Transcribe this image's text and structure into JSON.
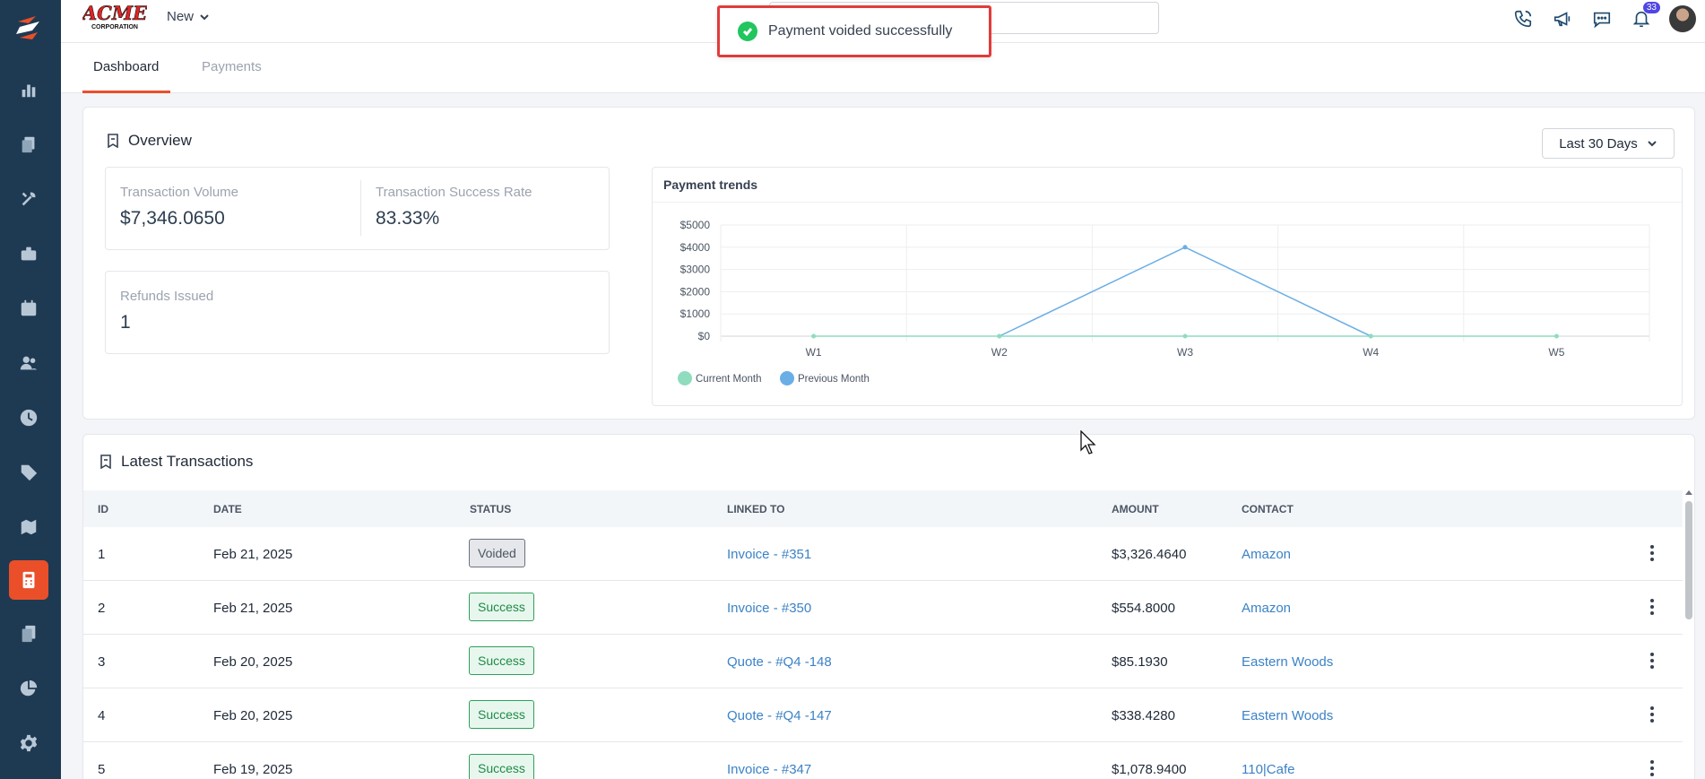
{
  "topbar": {
    "brand_text": "ACME",
    "brand_subtext": "CORPORATION",
    "new_label": "New",
    "notification_count": "33"
  },
  "toast": {
    "message": "Payment voided successfully"
  },
  "tabs": [
    {
      "label": "Dashboard",
      "active": true
    },
    {
      "label": "Payments",
      "active": false
    }
  ],
  "overview": {
    "title": "Overview",
    "range_label": "Last 30 Days",
    "transaction_volume_label": "Transaction Volume",
    "transaction_volume_value": "$7,346.0650",
    "success_rate_label": "Transaction Success Rate",
    "success_rate_value": "83.33%",
    "refunds_label": "Refunds Issued",
    "refunds_value": "1"
  },
  "chart_data": {
    "type": "line",
    "title": "Payment trends",
    "categories": [
      "W1",
      "W2",
      "W3",
      "W4",
      "W5"
    ],
    "y_ticks": [
      "$0",
      "$1000",
      "$2000",
      "$3000",
      "$4000",
      "$5000"
    ],
    "ylim": [
      0,
      5000
    ],
    "series": [
      {
        "name": "Current Month",
        "color": "#8fdcbf",
        "values": [
          0,
          0,
          0,
          0,
          0
        ]
      },
      {
        "name": "Previous Month",
        "color": "#6aaee6",
        "values": [
          null,
          0,
          4000,
          0,
          null
        ]
      }
    ],
    "legend_position": "bottom-left",
    "grid": true
  },
  "transactions": {
    "title": "Latest Transactions",
    "columns": [
      "ID",
      "DATE",
      "STATUS",
      "LINKED TO",
      "AMOUNT",
      "CONTACT"
    ],
    "rows": [
      {
        "id": "1",
        "date": "Feb 21, 2025",
        "status": "Voided",
        "linked": "Invoice - #351",
        "amount": "$3,326.4640",
        "contact": "Amazon"
      },
      {
        "id": "2",
        "date": "Feb 21, 2025",
        "status": "Success",
        "linked": "Invoice - #350",
        "amount": "$554.8000",
        "contact": "Amazon"
      },
      {
        "id": "3",
        "date": "Feb 20, 2025",
        "status": "Success",
        "linked": "Quote - #Q4 -148",
        "amount": "$85.1930",
        "contact": "Eastern Woods"
      },
      {
        "id": "4",
        "date": "Feb 20, 2025",
        "status": "Success",
        "linked": "Quote - #Q4 -147",
        "amount": "$338.4280",
        "contact": "Eastern Woods"
      },
      {
        "id": "5",
        "date": "Feb 19, 2025",
        "status": "Success",
        "linked": "Invoice - #347",
        "amount": "$1,078.9400",
        "contact": "110|Cafe"
      }
    ]
  },
  "colors": {
    "sidebar": "#1e3a52",
    "accent": "#ea4f2a",
    "link": "#3b82c6",
    "success": "#1f8a47"
  }
}
